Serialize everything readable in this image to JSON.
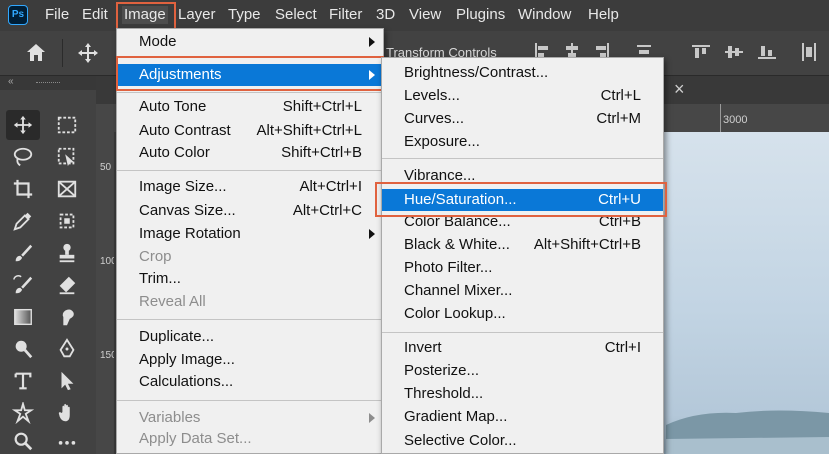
{
  "app": {
    "logo": "Ps"
  },
  "menubar": {
    "items": [
      "File",
      "Edit",
      "Image",
      "Layer",
      "Type",
      "Select",
      "Filter",
      "3D",
      "View",
      "Plugins",
      "Window",
      "Help"
    ],
    "active": "Image"
  },
  "options_bar": {
    "transform_controls": "Transform Controls",
    "icons": [
      "home-icon",
      "move-tool-icon"
    ]
  },
  "toolbar": {
    "collapse": "«",
    "tools": [
      "move-tool",
      "marquee-tool",
      "lasso-tool",
      "object-select-tool",
      "crop-tool",
      "frame-tool",
      "eyedropper-tool",
      "patch-tool",
      "brush-tool",
      "clone-stamp-tool",
      "history-brush-tool",
      "eraser-tool",
      "gradient-tool",
      "smudge-tool",
      "dodge-tool",
      "pen-tool",
      "type-tool",
      "path-select-tool",
      "custom-shape-tool",
      "hand-tool",
      "zoom-tool",
      "more-tools"
    ]
  },
  "document": {
    "tab_close": "×",
    "ruler_top_label": "3000",
    "ruler_left_labels": [
      "50",
      "100",
      "150"
    ]
  },
  "image_menu": {
    "items": [
      {
        "label": "Mode",
        "shortcut": "",
        "submenu": true,
        "disabled": false
      },
      {
        "label": "Adjustments",
        "shortcut": "",
        "submenu": true,
        "disabled": false,
        "highlighted": true
      },
      {
        "label": "Auto Tone",
        "shortcut": "Shift+Ctrl+L"
      },
      {
        "label": "Auto Contrast",
        "shortcut": "Alt+Shift+Ctrl+L"
      },
      {
        "label": "Auto Color",
        "shortcut": "Shift+Ctrl+B"
      },
      {
        "label": "Image Size...",
        "shortcut": "Alt+Ctrl+I"
      },
      {
        "label": "Canvas Size...",
        "shortcut": "Alt+Ctrl+C"
      },
      {
        "label": "Image Rotation",
        "shortcut": "",
        "submenu": true
      },
      {
        "label": "Crop",
        "shortcut": "",
        "disabled": true
      },
      {
        "label": "Trim...",
        "shortcut": ""
      },
      {
        "label": "Reveal All",
        "shortcut": "",
        "disabled": true
      },
      {
        "label": "Duplicate...",
        "shortcut": ""
      },
      {
        "label": "Apply Image...",
        "shortcut": ""
      },
      {
        "label": "Calculations...",
        "shortcut": ""
      },
      {
        "label": "Variables",
        "shortcut": "",
        "submenu": true,
        "disabled": true
      },
      {
        "label": "Apply Data Set...",
        "shortcut": "",
        "disabled": true
      }
    ]
  },
  "adjustments_menu": {
    "items": [
      {
        "label": "Brightness/Contrast...",
        "shortcut": ""
      },
      {
        "label": "Levels...",
        "shortcut": "Ctrl+L"
      },
      {
        "label": "Curves...",
        "shortcut": "Ctrl+M"
      },
      {
        "label": "Exposure...",
        "shortcut": ""
      },
      {
        "label": "Vibrance...",
        "shortcut": ""
      },
      {
        "label": "Hue/Saturation...",
        "shortcut": "Ctrl+U",
        "highlighted": true
      },
      {
        "label": "Color Balance...",
        "shortcut": "Ctrl+B"
      },
      {
        "label": "Black & White...",
        "shortcut": "Alt+Shift+Ctrl+B"
      },
      {
        "label": "Photo Filter...",
        "shortcut": ""
      },
      {
        "label": "Channel Mixer...",
        "shortcut": ""
      },
      {
        "label": "Color Lookup...",
        "shortcut": ""
      },
      {
        "label": "Invert",
        "shortcut": "Ctrl+I"
      },
      {
        "label": "Posterize...",
        "shortcut": ""
      },
      {
        "label": "Threshold...",
        "shortcut": ""
      },
      {
        "label": "Gradient Map...",
        "shortcut": ""
      },
      {
        "label": "Selective Color...",
        "shortcut": ""
      }
    ]
  },
  "colors": {
    "highlight": "#0a78d7",
    "annotation": "#e0623f",
    "menu_bg": "#f0f0f0",
    "chrome": "#3c3c3c"
  }
}
